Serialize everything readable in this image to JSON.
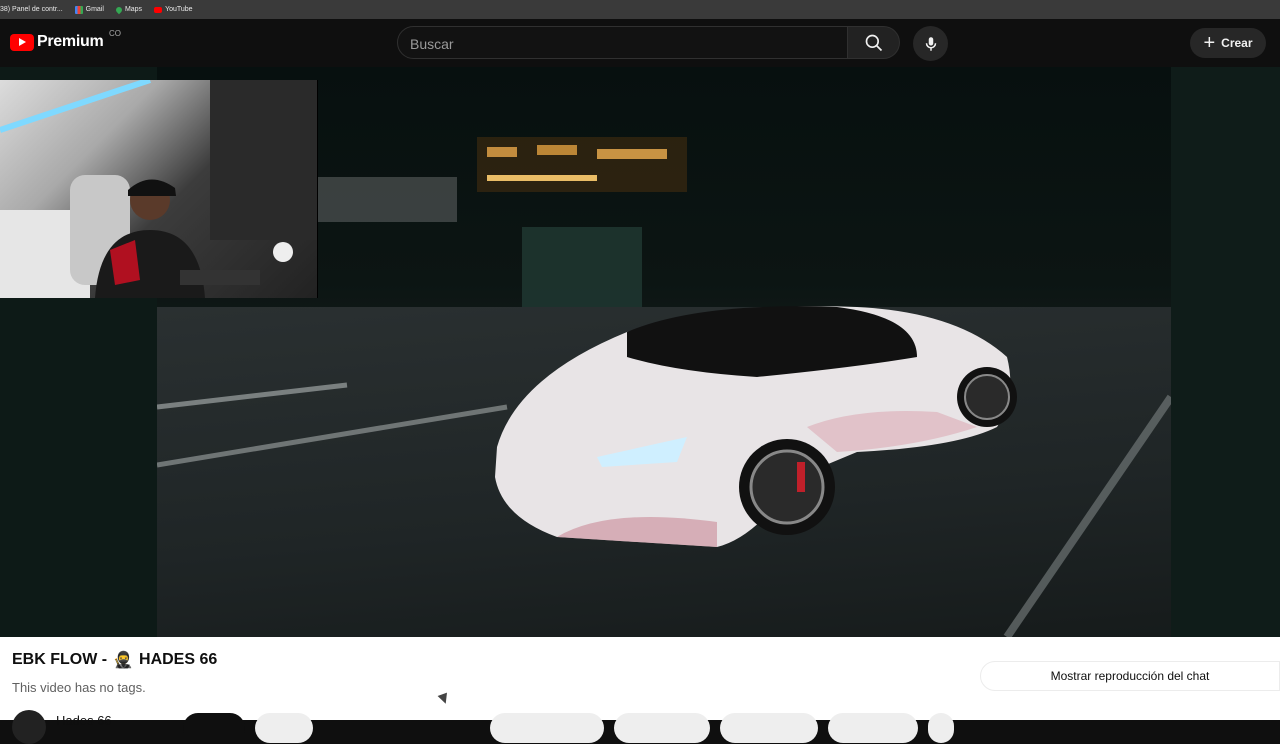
{
  "bookmarks": [
    {
      "label": "38) Panel de contr...",
      "icon": "panel-icon",
      "color": "#3a3a3a"
    },
    {
      "label": "Gmail",
      "icon": "gmail-icon",
      "color": "#ea4335"
    },
    {
      "label": "Maps",
      "icon": "maps-icon",
      "color": "#34a853"
    },
    {
      "label": "YouTube",
      "icon": "youtube-icon",
      "color": "#ff0000"
    }
  ],
  "header": {
    "logo_text": "Premium",
    "country": "CO",
    "search_placeholder": "Buscar",
    "create_label": "Crear"
  },
  "video": {
    "title_prefix": "EBK FLOW -",
    "title_emoji": "🥷",
    "title_channel": "HADES 66",
    "tags_text": "This video has no tags.",
    "channel_name": "Hades 66",
    "chat_button": "Mostrar reproducción del chat"
  },
  "colors": {
    "brand": "#ff0000",
    "background": "#0f0f0f",
    "surface": "#ffffff"
  }
}
